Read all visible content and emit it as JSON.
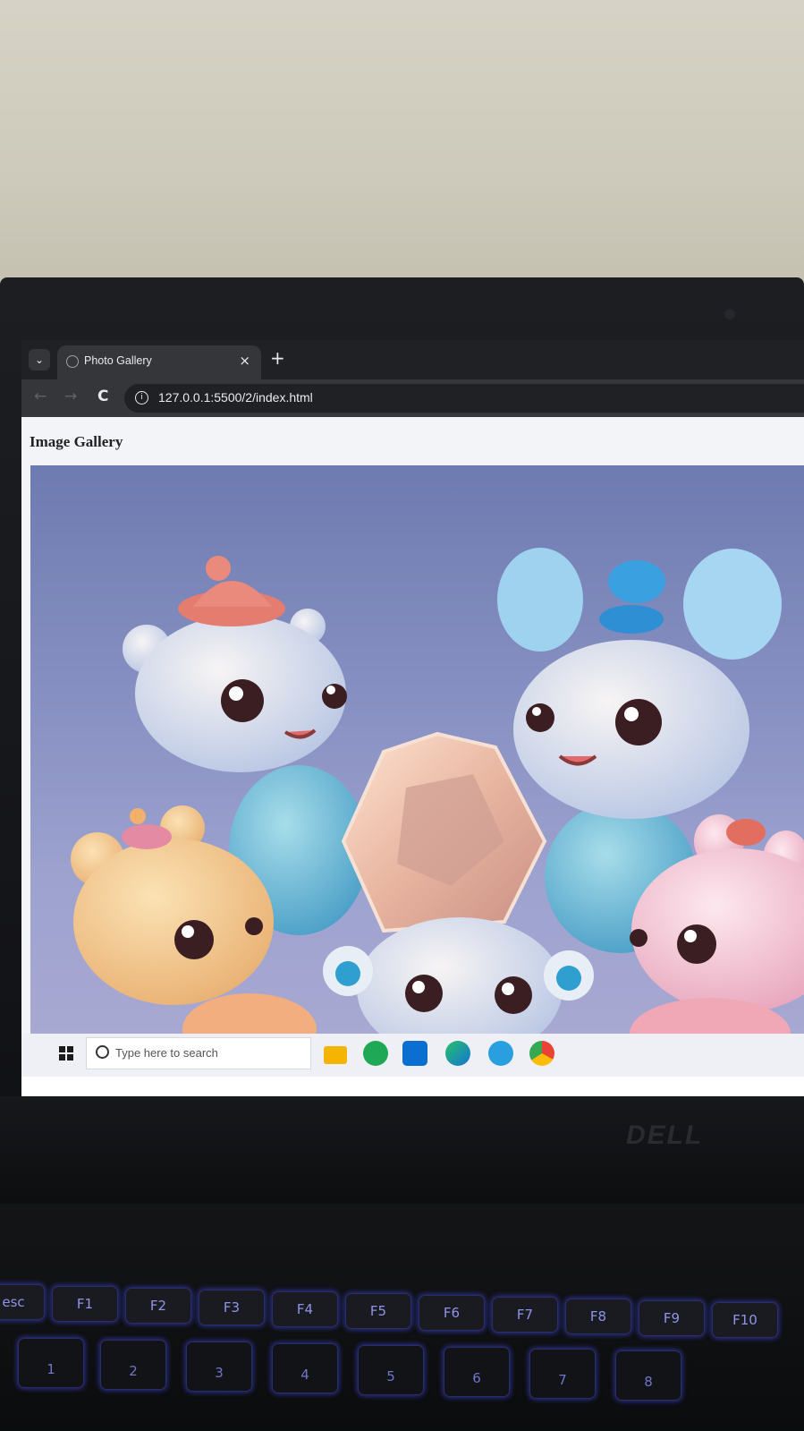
{
  "browser": {
    "tab_title": "Photo Gallery",
    "tab_close": "×",
    "new_tab": "+",
    "tab_search": "⌄",
    "back": "←",
    "forward": "→",
    "reload": "C",
    "url": "127.0.0.1:5500/2/index.html",
    "site_info": "i"
  },
  "page": {
    "heading": "Image Gallery"
  },
  "taskbar": {
    "search_placeholder": "Type here to search",
    "apps": [
      "file-explorer-icon",
      "whatsapp-icon",
      "vscode-icon",
      "edge-icon",
      "telegram-icon",
      "chrome-icon"
    ]
  },
  "hardware": {
    "brand": "DELL"
  },
  "keyboard": {
    "function_row": [
      "esc",
      "F1",
      "F2",
      "F3",
      "F4",
      "F5",
      "F6",
      "F7",
      "F8",
      "F9",
      "F10"
    ],
    "number_row": [
      "1",
      "2",
      "3",
      "4",
      "5",
      "6",
      "7",
      "8"
    ]
  },
  "colors": {
    "chrome_dark": "#202124",
    "chrome_tab": "#35363a",
    "gallery_bg": "#8790c2",
    "key_glow": "#4650ff"
  }
}
